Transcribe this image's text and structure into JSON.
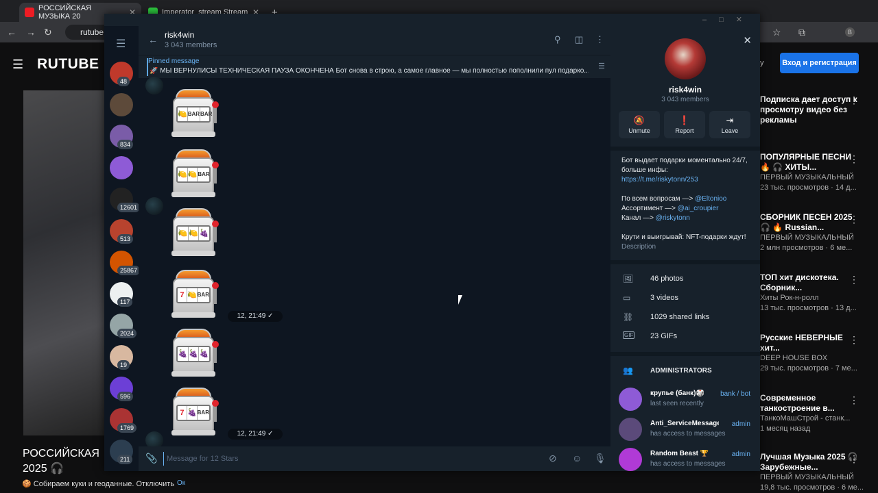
{
  "browser": {
    "tabs": [
      {
        "title": "РОССИЙСКАЯ МУЗЫКА 20",
        "active": true,
        "favicon_color": "#ed1c24"
      },
      {
        "title": "Imperator_stream Stream",
        "active": false,
        "favicon_color": "#2ecc40"
      }
    ],
    "new_tab": "+",
    "url": "rutube.ru"
  },
  "rutube": {
    "logo": "RUTUBE",
    "login_button": "Вход и регистрация",
    "promo_fragment": "у",
    "video_title": "РОССИЙСКАЯ\n2025 🎧",
    "cookie_text": "Собираем куки и геоданные. Отключить",
    "cookie_button": "Ок",
    "sidebar": [
      {
        "title": "Подписка дает доступ к просмотру видео без рекламы",
        "sub": ""
      },
      {
        "title": "ПОПУЛЯРНЫЕ ПЕСНИ 🔥 🎧 ХИТЫ...",
        "sub": "ПЕРВЫЙ МУЗЫКАЛЬНЫЙ\n23 тыс. просмотров · 14 д..."
      },
      {
        "title": "СБОРНИК ПЕСЕН 2025 🎧 🔥 Russian...",
        "sub": "ПЕРВЫЙ МУЗЫКАЛЬНЫЙ\n2 млн просмотров · 6 ме..."
      },
      {
        "title": "ТОП хит дискотека. Сборник...",
        "sub": "Хиты Рок-н-ролл\n13 тыс. просмотров · 13 д..."
      },
      {
        "title": "Русские НЕВЕРНЫЕ хит...",
        "sub": "DEEP HOUSE BOX\n29 тыс. просмотров · 7 ме..."
      },
      {
        "title": "Современное танкостроение в...",
        "sub": "ТанкоМашСтрой - станк...\n1 месяц назад"
      },
      {
        "title": "Лучшая Музыка 2025 🎧 Зарубежные...",
        "sub": "ПЕРВЫЙ МУЗЫКАЛЬНЫЙ\n19,8 тыс. просмотров · 6 ме..."
      }
    ]
  },
  "telegram": {
    "chat_list": [
      {
        "badge": "48",
        "color": "#c0392b"
      },
      {
        "badge": "",
        "color": "#5d4a3a"
      },
      {
        "badge": "834",
        "color": "#7a5ca8"
      },
      {
        "badge": "",
        "color": "#8e5bd6"
      },
      {
        "badge": "12601",
        "color": "#222"
      },
      {
        "badge": "513",
        "color": "#b8432e"
      },
      {
        "badge": "25867",
        "color": "#d35400"
      },
      {
        "badge": "117",
        "color": "#ecf0f1"
      },
      {
        "badge": "2024",
        "color": "#95a5a6"
      },
      {
        "badge": "19",
        "color": "#d8b8a0"
      },
      {
        "badge": "596",
        "color": "#6c3fd6"
      },
      {
        "badge": "1769",
        "color": "#a33"
      },
      {
        "badge": "211",
        "color": "#2c3e50"
      }
    ],
    "chat": {
      "name": "risk4win",
      "members": "3 043 members",
      "pinned_label": "Pinned message",
      "pinned_text": "🚀 МЫ ВЕРНУЛИСЫ ТЕХНИЧЕСКАЯ ПАУЗА ОКОНЧЕНА  Бот снова в строю, а самое главное — мы полностью пополнили пул подарко...",
      "slots": [
        {
          "reels": [
            "🍋",
            "BAR",
            "BAR"
          ],
          "time": ""
        },
        {
          "reels": [
            "🍋",
            "🍋",
            "BAR"
          ],
          "time": ""
        },
        {
          "reels": [
            "🍋",
            "🍋",
            "🍇"
          ],
          "time": ""
        },
        {
          "reels": [
            "7",
            "🍋",
            "BAR"
          ],
          "time": "12, 21:49 ✓"
        },
        {
          "reels": [
            "🍇",
            "🍇",
            "🍇"
          ],
          "time": ""
        },
        {
          "reels": [
            "7",
            "🍇",
            "BAR"
          ],
          "time": "12, 21:49 ✓"
        }
      ],
      "input_placeholder": "Message for 12 Stars"
    },
    "info": {
      "name": "risk4win",
      "members": "3 043 members",
      "actions": [
        {
          "label": "Unmute",
          "icon": "bell-off-icon"
        },
        {
          "label": "Report",
          "icon": "alert-icon"
        },
        {
          "label": "Leave",
          "icon": "leave-icon"
        }
      ],
      "desc_line1": "Бот выдает подарки моментально 24/7, больше инфы:",
      "desc_link": "https://t.me/riskytonn/253",
      "desc_q1": "По всем вопросам —> ",
      "desc_q1_link": "@Eltonioo",
      "desc_q2": "Ассортимент —> ",
      "desc_q2_link": "@ai_croupier",
      "desc_q3": "Канал —> ",
      "desc_q3_link": "@riskytonn",
      "desc_tail": "Крути и выигрывай: NFT-подарки ждут!",
      "desc_caption": "Description",
      "media": [
        {
          "label": "46 photos",
          "icon": "photo-icon"
        },
        {
          "label": "3 videos",
          "icon": "video-icon"
        },
        {
          "label": "1029 shared links",
          "icon": "link-icon"
        },
        {
          "label": "23 GIFs",
          "icon": "gif-icon"
        }
      ],
      "admins_title": "ADMINISTRATORS",
      "admins": [
        {
          "name": "крупье (банк)🎲",
          "status": "last seen recently",
          "role": "bank / bot",
          "color": "#8e5bd6"
        },
        {
          "name": "Anti_ServiceMessageB...",
          "status": "has access to messages",
          "role": "admin",
          "color": "#5b4a7a"
        },
        {
          "name": "Random Beast 🏆",
          "status": "has access to messages",
          "role": "admin",
          "color": "#b03ad6"
        }
      ]
    }
  }
}
